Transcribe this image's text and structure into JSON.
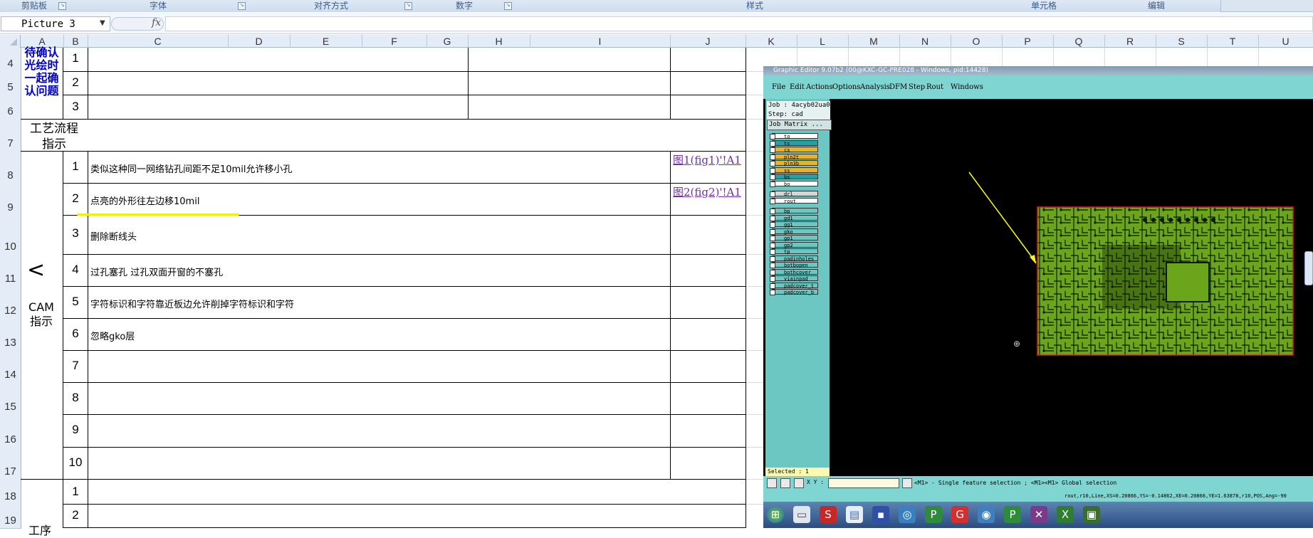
{
  "ribbon": {
    "groups": [
      "剪贴板",
      "字体",
      "对齐方式",
      "数字",
      "样式",
      "单元格",
      "编辑"
    ]
  },
  "formula_bar": {
    "name_box": "Picture 3",
    "fx_label": "fx",
    "formula": ""
  },
  "columns": [
    "A",
    "B",
    "C",
    "D",
    "E",
    "F",
    "G",
    "H",
    "I",
    "J",
    "K",
    "L",
    "M",
    "N",
    "O",
    "P",
    "Q",
    "R",
    "S",
    "T",
    "U"
  ],
  "rows": [
    "4",
    "5",
    "6",
    "7",
    "8",
    "9",
    "10",
    "11",
    "12",
    "13",
    "14",
    "15",
    "16",
    "17",
    "18",
    "19"
  ],
  "sheet": {
    "pending_label": "待确认光绘时一起确认问题",
    "process_label": "工艺流程指示",
    "cam_label": "CAM 指示",
    "cam_arrow": "<",
    "bottom_label": "工序",
    "pending_nums": [
      "1",
      "2",
      "3"
    ],
    "cam_nums": [
      "1",
      "2",
      "3",
      "4",
      "5",
      "6",
      "7",
      "8",
      "9",
      "10"
    ],
    "cam_texts": [
      "类似这种同一网络钻孔间距不足10mil允许移小孔",
      "点亮的外形往左边移10mil",
      "删除断线头",
      "过孔塞孔 过孔双面开窗的不塞孔",
      "字符标识和字符靠近板边允许削掉字符标识和字符",
      "忽略gko层",
      "",
      "",
      "",
      ""
    ],
    "links": [
      "图1(fig1)'!A1",
      "图2(fig2)'!A1"
    ],
    "bottom_nums": [
      "1",
      "2"
    ]
  },
  "graphic_editor": {
    "title": "Graphic Editor 9.07b2 (00@KXC-GC-PRE028 - Windows, pid:14428)",
    "menu": [
      "File",
      "Edit",
      "Actions",
      "Options",
      "Analysis",
      "DFM",
      "Step",
      "Rout",
      "Windows"
    ],
    "job": "Job : 4acyb02ua0",
    "step": "Step: cad",
    "matrix_button": "Job Matrix ...",
    "layers": [
      "to",
      "ts",
      "cs",
      "pln2t",
      "pln3b",
      "ss",
      "bs",
      "bo",
      "drl",
      "rout",
      "bp",
      "gd1",
      "gg1",
      "gko",
      "gp1",
      "gp2",
      "tp",
      "padinholes",
      "botbopen",
      "bothcover",
      "viainpad",
      "padcover_t",
      "padcover_b"
    ],
    "selected": "Selected : 1",
    "xy_label": "X Y :",
    "hint": "<M1> - Single feature selection ; <M1><M1> Global selection",
    "readout": "rout,r10,Line,XS=0.20866,YS=-0.14862,XE=0.20866,YE=1.63878,r10,POS,Ang=-90"
  },
  "colors": {
    "ribbon_bg": "#dbe5f1",
    "header_bg": "#e4ecf7",
    "label_blue": "#0000cc",
    "link_purple": "#7030a0",
    "editor_menu": "#7fd5d1",
    "board_green": "#6aa51b",
    "board_outline": "#e0182f",
    "arrow_yellow": "#ffff00"
  }
}
